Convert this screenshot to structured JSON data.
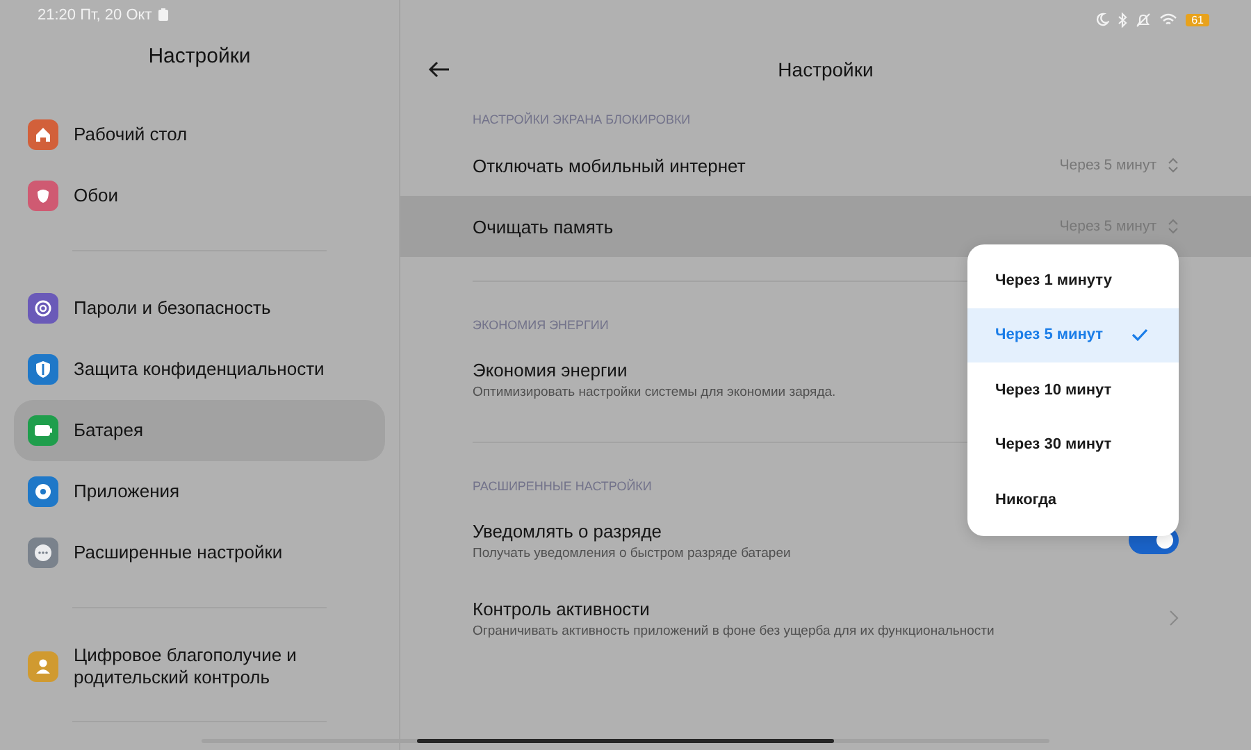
{
  "status_bar": {
    "time": "21:20 Пт, 20 Окт",
    "battery": "61"
  },
  "sidebar": {
    "title": "Настройки",
    "groups": [
      {
        "items": [
          {
            "label": "Рабочий стол",
            "color": "#d2603a",
            "selected": false
          },
          {
            "label": "Обои",
            "color": "#cf5a72",
            "selected": false
          }
        ]
      },
      {
        "items": [
          {
            "label": "Пароли и безопасность",
            "color": "#6a5ab8",
            "selected": false
          },
          {
            "label": "Защита конфиденциальности",
            "color": "#1f78c8",
            "selected": false
          },
          {
            "label": "Батарея",
            "color": "#1f9e4c",
            "selected": true
          },
          {
            "label": "Приложения",
            "color": "#1f78c8",
            "selected": false
          },
          {
            "label": "Расширенные настройки",
            "color": "#7a828c",
            "selected": false
          }
        ]
      },
      {
        "items": [
          {
            "label": "Цифровое благополучие и родительский контроль",
            "color": "#d09a30",
            "selected": false
          }
        ]
      }
    ]
  },
  "page": {
    "title": "Настройки",
    "sections": [
      {
        "header": "НАСТРОЙКИ ЭКРАНА БЛОКИРОВКИ",
        "rows": [
          {
            "kind": "select",
            "title": "Отключать мобильный интернет",
            "value": "Через 5 минут",
            "selected": false
          },
          {
            "kind": "select",
            "title": "Очищать память",
            "value": "Через 5 минут",
            "selected": true
          }
        ]
      },
      {
        "header": "ЭКОНОМИЯ ЭНЕРГИИ",
        "rows": [
          {
            "kind": "plain",
            "title": "Экономия энергии",
            "subtitle": "Оптимизировать настройки системы для экономии заряда.",
            "selected": false
          }
        ]
      },
      {
        "header": "РАСШИРЕННЫЕ НАСТРОЙКИ",
        "rows": [
          {
            "kind": "toggle",
            "title": "Уведомлять о разряде",
            "subtitle": "Получать уведомления о быстром разряде батареи",
            "on": true,
            "selected": false
          },
          {
            "kind": "nav",
            "title": "Контроль активности",
            "subtitle": "Ограничивать активность приложений в фоне без ущерба для их функциональности",
            "selected": false
          }
        ]
      }
    ]
  },
  "dropdown": {
    "options": [
      {
        "label": "Через 1 минуту",
        "selected": false
      },
      {
        "label": "Через 5 минут",
        "selected": true
      },
      {
        "label": "Через 10 минут",
        "selected": false
      },
      {
        "label": "Через 30 минут",
        "selected": false
      },
      {
        "label": "Никогда",
        "selected": false
      }
    ]
  }
}
